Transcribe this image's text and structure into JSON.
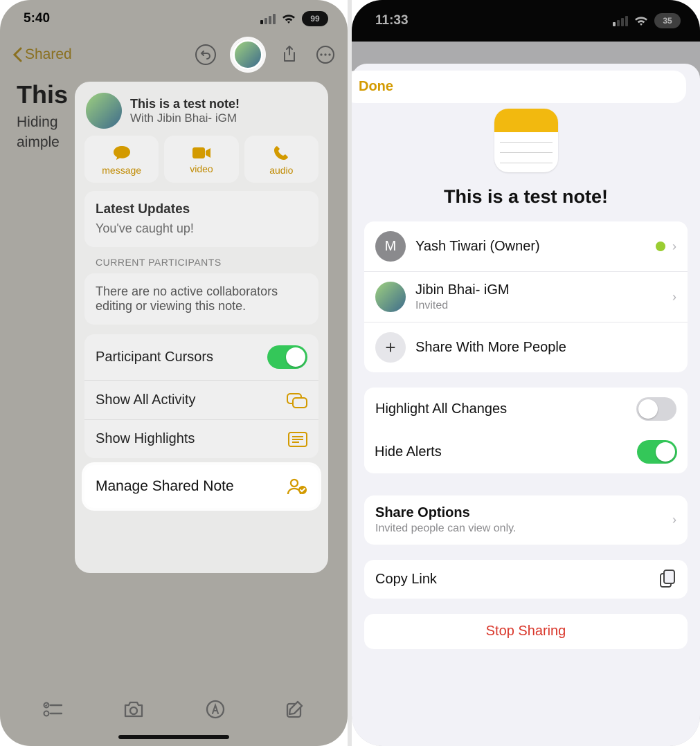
{
  "left": {
    "status": {
      "time": "5:40",
      "battery": "99"
    },
    "nav": {
      "back": "Shared"
    },
    "note": {
      "title_bg": "This",
      "body_line1": "Hiding ",
      "body_line2": "aimple"
    },
    "popover": {
      "title": "This is a test note!",
      "subtitle": "With Jibin Bhai- iGM",
      "contact": {
        "message": "message",
        "video": "video",
        "audio": "audio"
      },
      "updates": {
        "title": "Latest Updates",
        "body": "You've caught up!"
      },
      "participants_caption": "CURRENT PARTICIPANTS",
      "participants_body": "There are no active collaborators editing or viewing this note.",
      "rows": {
        "cursors": "Participant Cursors",
        "activity": "Show All Activity",
        "highlights": "Show Highlights",
        "manage": "Manage Shared Note"
      }
    }
  },
  "right": {
    "status": {
      "time": "11:33",
      "battery": "35"
    },
    "done": "Done",
    "title": "This is a test note!",
    "people": {
      "owner": {
        "initial": "M",
        "name": "Yash Tiwari (Owner)"
      },
      "invitee": {
        "name": "Jibin Bhai- iGM",
        "status": "Invited"
      },
      "share_more": "Share With More People"
    },
    "options": {
      "highlight_changes": "Highlight All Changes",
      "hide_alerts": "Hide Alerts"
    },
    "share_options": {
      "title": "Share Options",
      "sub": "Invited people can view only."
    },
    "copy_link": "Copy Link",
    "stop": "Stop Sharing"
  }
}
